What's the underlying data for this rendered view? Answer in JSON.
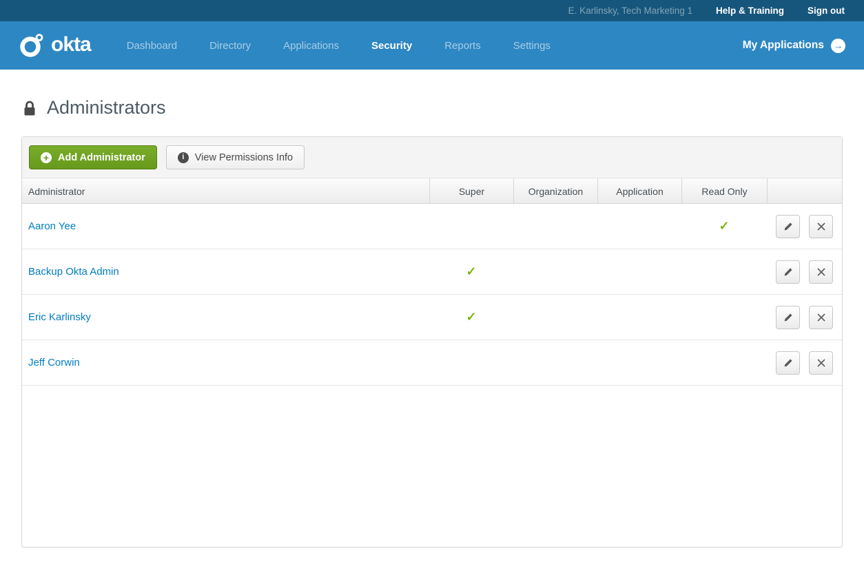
{
  "topbar": {
    "user": "E. Karlinsky, Tech Marketing 1",
    "help": "Help & Training",
    "signout": "Sign out"
  },
  "nav": {
    "brand": "okta",
    "items": [
      {
        "label": "Dashboard",
        "active": false
      },
      {
        "label": "Directory",
        "active": false
      },
      {
        "label": "Applications",
        "active": false
      },
      {
        "label": "Security",
        "active": true
      },
      {
        "label": "Reports",
        "active": false
      },
      {
        "label": "Settings",
        "active": false
      }
    ],
    "my_applications": "My Applications"
  },
  "page": {
    "title": "Administrators"
  },
  "toolbar": {
    "add_button": "Add Administrator",
    "permissions_button": "View Permissions Info"
  },
  "table": {
    "columns": [
      "Administrator",
      "Super",
      "Organization",
      "Application",
      "Read Only",
      ""
    ],
    "role_keys": [
      "super",
      "organization",
      "application",
      "read_only"
    ],
    "rows": [
      {
        "name": "Aaron Yee",
        "super": false,
        "organization": false,
        "application": false,
        "read_only": true
      },
      {
        "name": "Backup Okta Admin",
        "super": true,
        "organization": false,
        "application": false,
        "read_only": false
      },
      {
        "name": "Eric Karlinsky",
        "super": true,
        "organization": false,
        "application": false,
        "read_only": false
      },
      {
        "name": "Jeff Corwin",
        "super": false,
        "organization": false,
        "application": false,
        "read_only": false
      }
    ]
  },
  "icons": {
    "check": "✓",
    "plus": "+",
    "info": "i",
    "arrow": "→"
  },
  "colors": {
    "topbar_bg": "#17567c",
    "nav_bg": "#2d87c3",
    "link_blue": "#007dc1",
    "green_button": "#71a425",
    "check_green": "#7eb212",
    "title_text": "#4c5a64",
    "panel_border": "#d8d8d8",
    "header_text": "#474f56",
    "row_border": "#e6e6e6"
  }
}
